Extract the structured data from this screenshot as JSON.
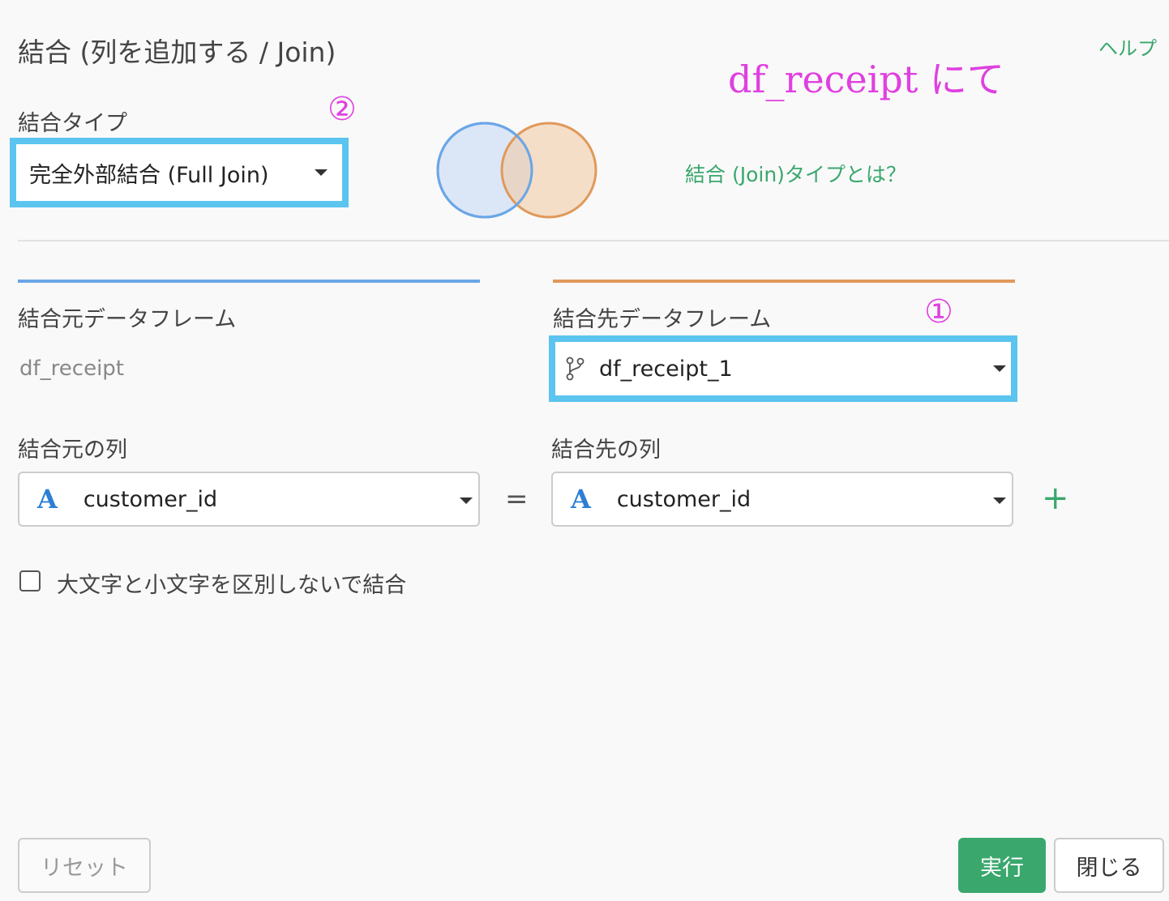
{
  "dialog": {
    "title": "結合 (列を追加する / Join)",
    "help_link": "ヘルプ"
  },
  "annotations": {
    "main": "df_receipt  にて",
    "marker_1": "①",
    "marker_2": "②",
    "highlight_color": "#5bc4ef",
    "text_color": "#e040e0"
  },
  "join_type": {
    "label": "結合タイプ",
    "selected": "完全外部結合 (Full Join)",
    "info_link": "結合 (Join)タイプとは？"
  },
  "venn": {
    "left_color": "#6aa6e6",
    "right_color": "#e0995a"
  },
  "source": {
    "frame_label": "結合元データフレーム",
    "frame_value": "df_receipt",
    "column_label": "結合元の列",
    "column_selected": "customer_id",
    "column_type_icon": "A"
  },
  "target": {
    "frame_label": "結合先データフレーム",
    "frame_selected": "df_receipt_1",
    "frame_icon": "branch-icon",
    "column_label": "結合先の列",
    "column_selected": "customer_id",
    "column_type_icon": "A"
  },
  "equals_sign": "=",
  "add_key_label": "+",
  "case_insensitive": {
    "label": "大文字と小文字を区別しないで結合",
    "checked": false
  },
  "buttons": {
    "reset": "リセット",
    "run": "実行",
    "close": "閉じる"
  },
  "colors": {
    "accent_green": "#3aa76d"
  }
}
